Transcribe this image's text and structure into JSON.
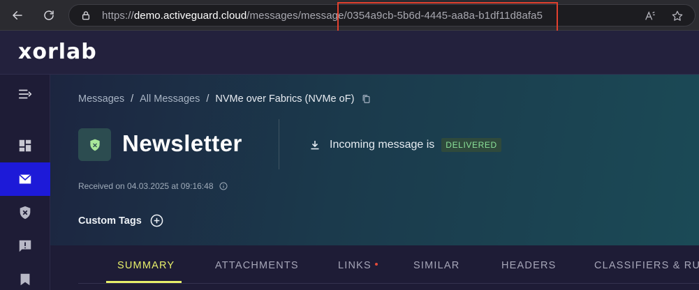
{
  "browser": {
    "url_scheme": "https://",
    "url_host": "demo.activeguard.cloud",
    "url_path": "/messages/message/",
    "url_id": "0354a9cb-5b6d-4445-aa8a-b1df11d8afa5",
    "highlight_color": "#e2402e"
  },
  "app": {
    "logo": "xorlab"
  },
  "sidebar": {
    "items": [
      {
        "icon": "menu-collapse-icon",
        "active": false
      },
      {
        "icon": "dashboard-icon",
        "active": false
      },
      {
        "icon": "mail-icon",
        "active": true
      },
      {
        "icon": "shield-x-icon",
        "active": false
      },
      {
        "icon": "feedback-icon",
        "active": false
      },
      {
        "icon": "bookmark-icon",
        "active": false
      }
    ],
    "active_color": "#1d1ad8"
  },
  "breadcrumb": {
    "items": [
      "Messages",
      "All Messages",
      "NVMe over Fabrics (NVMe oF)"
    ],
    "separator": "/"
  },
  "message": {
    "title": "Newsletter",
    "incoming_label": "Incoming message is",
    "status": "DELIVERED",
    "status_color": "#8be39a",
    "received": "Received on 04.03.2025 at 09:16:48"
  },
  "custom_tags": {
    "label": "Custom Tags"
  },
  "tabs": [
    {
      "label": "SUMMARY",
      "active": true
    },
    {
      "label": "ATTACHMENTS",
      "active": false
    },
    {
      "label": "LINKS",
      "active": false,
      "indicator": true
    },
    {
      "label": "SIMILAR",
      "active": false
    },
    {
      "label": "HEADERS",
      "active": false
    },
    {
      "label": "CLASSIFIERS & RULES",
      "active": false
    }
  ],
  "accent_color": "#e7ef6a"
}
